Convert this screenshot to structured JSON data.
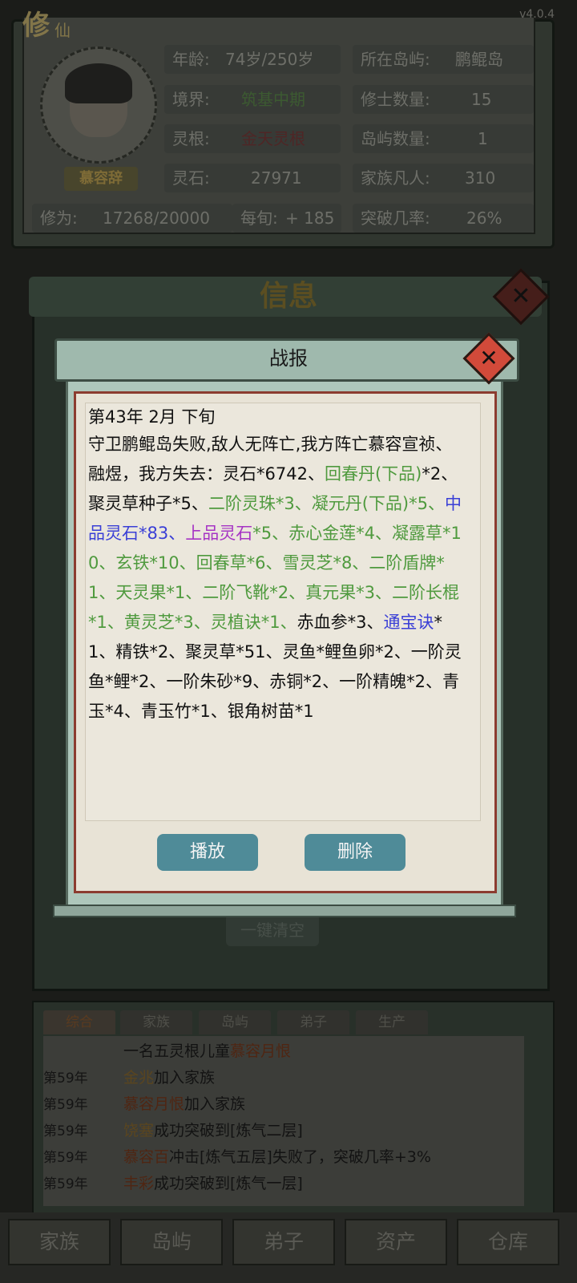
{
  "app": {
    "title_main": "修",
    "title_sub": "仙",
    "version": "v4.0.4"
  },
  "player": {
    "name": "慕容辞",
    "stats": [
      {
        "key": "年龄:",
        "value": "74岁/250岁"
      },
      {
        "key": "所在岛屿:",
        "value": "鹏鲲岛"
      },
      {
        "key": "境界:",
        "value": "筑基中期"
      },
      {
        "key": "修士数量:",
        "value": "15"
      },
      {
        "key": "灵根:",
        "value": "金天灵根"
      },
      {
        "key": "岛屿数量:",
        "value": "1"
      },
      {
        "key": "灵石:",
        "value": "27971"
      },
      {
        "key": "家族凡人:",
        "value": "310"
      },
      {
        "key": "修为:",
        "value": "17268/20000"
      },
      {
        "key": "每旬:",
        "value": "+ 185"
      },
      {
        "key": "突破几率:",
        "value": "26%"
      }
    ]
  },
  "info_panel": {
    "title": "信息",
    "close_icon": "close-icon",
    "clear_button": "一键清空"
  },
  "battle_report": {
    "title": "战报",
    "date": "第43年  2月  下旬",
    "segments": [
      {
        "t": "守卫鹏鲲岛失败,敌人无阵亡,我方阵亡慕容宣祯、融煜，我方失去：灵石*6742、",
        "c": ""
      },
      {
        "t": "回春丹(下品)",
        "c": "g"
      },
      {
        "t": "*2、聚灵草种子*5、",
        "c": ""
      },
      {
        "t": "二阶灵珠*3、凝元丹(下品)*5、",
        "c": "g"
      },
      {
        "t": "中品灵石*83、",
        "c": "b"
      },
      {
        "t": "上品灵石",
        "c": "p"
      },
      {
        "t": "*5、赤心金莲*4、凝露草*10、玄铁*10、回春草*6、雪灵芝*8、二阶盾牌*1、天灵果*1、二阶飞靴*2、真元果*3、二阶长棍*1、黄灵芝*3、灵植诀*1、",
        "c": "g"
      },
      {
        "t": "赤血参*3、",
        "c": ""
      },
      {
        "t": "通宝诀",
        "c": "b"
      },
      {
        "t": "*1、精铁*2、聚灵草*51、灵鱼*鲤鱼卵*2、一阶灵鱼*鲤*2、一阶朱砂*9、赤铜*2、一阶精魄*2、青玉*4、青玉竹*1、银角树苗*1",
        "c": ""
      }
    ],
    "play_button": "播放",
    "delete_button": "删除"
  },
  "log": {
    "tabs": [
      "综合",
      "家族",
      "岛屿",
      "弟子",
      "生产"
    ],
    "active_tab": "综合",
    "lines": [
      {
        "year": "",
        "pre": "一名五灵根儿童",
        "name": "慕容月恨",
        "post": ""
      },
      {
        "year": "第59年",
        "pre": "",
        "name": "金兆",
        "post": "加入家族"
      },
      {
        "year": "第59年",
        "pre": "",
        "name": "慕容月恨",
        "post": "加入家族"
      },
      {
        "year": "第59年",
        "pre": "",
        "name": "饶塞",
        "post": "成功突破到[炼气二层]"
      },
      {
        "year": "第59年",
        "pre": "",
        "name": "慕容百",
        "post": "冲击[炼气五层]失败了，突破几率+3%"
      },
      {
        "year": "第59年",
        "pre": "",
        "name": "丰彩",
        "post": "成功突破到[炼气一层]"
      }
    ]
  },
  "nav": [
    "家族",
    "岛屿",
    "弟子",
    "资产",
    "仓库"
  ]
}
